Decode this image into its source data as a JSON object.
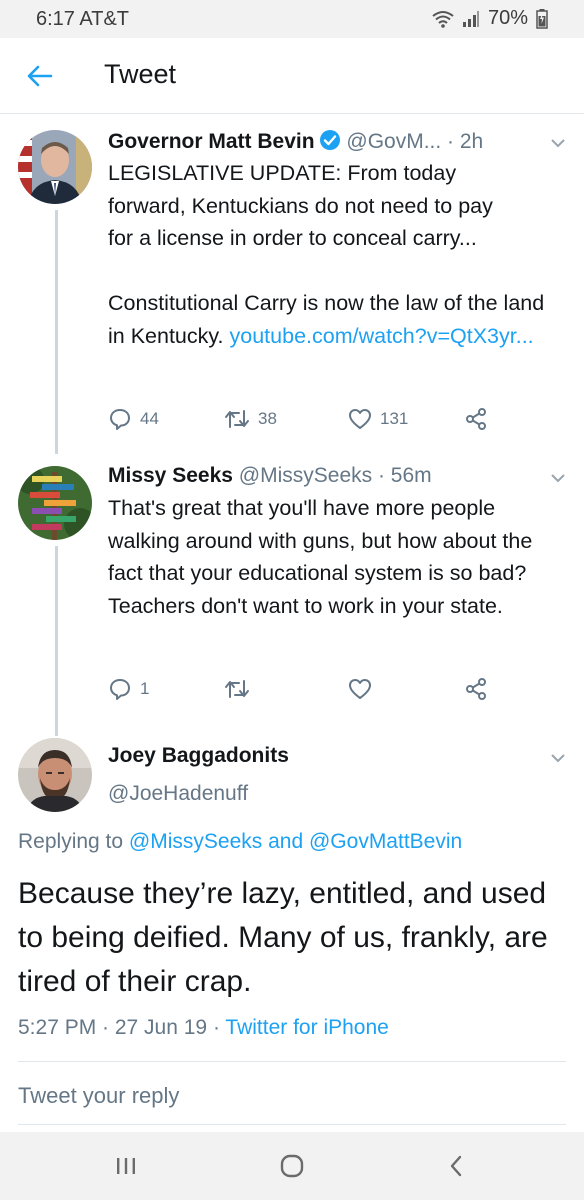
{
  "status_bar": {
    "time": "6:17 AT&T",
    "battery": "70%"
  },
  "header": {
    "title": "Tweet"
  },
  "tweets": [
    {
      "name": "Governor Matt Bevin",
      "meta": "@GovM... · 2h",
      "text_lines": [
        "LEGISLATIVE UPDATE: From today",
        "forward, Kentuckians do not need to pay",
        "for a license in order to conceal carry..."
      ],
      "text2_prefix": "Constitutional Carry is now the law of the land in Kentucky.",
      "link": "youtube.com/watch?v=QtX3yr...",
      "replies": "44",
      "retweets": "38",
      "likes": "131"
    },
    {
      "name": "Missy Seeks",
      "meta": "@MissySeeks · 56m",
      "text": "That's great that you'll have more people walking around with guns, but how about the fact that your educational system is so bad? Teachers don't want to work in your state.",
      "replies": "1",
      "retweets": "",
      "likes": ""
    }
  ],
  "main_tweet": {
    "name": "Joey Baggadonits",
    "handle": "@JoeHadenuff",
    "replying_prefix": "Replying to",
    "replying_user1": "@MissySeeks",
    "replying_and": "and",
    "replying_user2": "@GovMattBevin",
    "text": "Because they’re lazy, entitled, and used to being deified. Many of us, frankly, are tired of their crap.",
    "time": "5:27 PM · 27 Jun 19 ·",
    "source": "Twitter for iPhone"
  },
  "reply_box": {
    "placeholder": "Tweet your reply"
  },
  "colors": {
    "accent": "#1da1f2",
    "muted": "#657786",
    "text": "#14171a",
    "verified": "#1da1f2",
    "thread_line": "#ccd6dd"
  }
}
